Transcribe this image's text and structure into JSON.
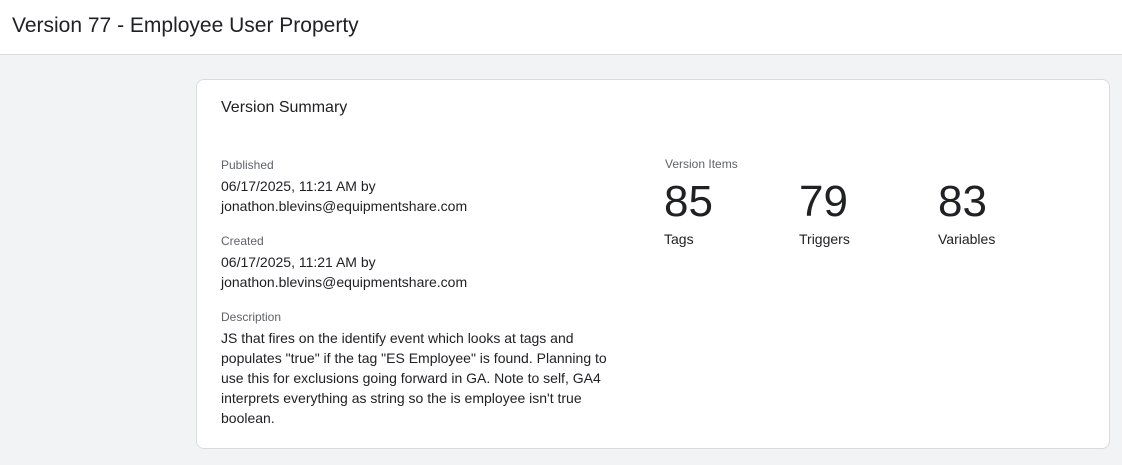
{
  "header": {
    "title": "Version 77 - Employee User Property"
  },
  "summary": {
    "title": "Version Summary",
    "published": {
      "label": "Published",
      "datetime": "06/17/2025, 11:21 AM by",
      "user": "jonathon.blevins@equipmentshare.com"
    },
    "created": {
      "label": "Created",
      "datetime": "06/17/2025, 11:21 AM by",
      "user": "jonathon.blevins@equipmentshare.com"
    },
    "description": {
      "label": "Description",
      "text": "JS that fires on the identify event which looks at tags and populates \"true\" if the tag \"ES Employee\" is found. Planning to use this for exclusions going forward in GA. Note to self, GA4 interprets everything as string so the is employee isn't true boolean."
    },
    "version_items": {
      "label": "Version Items",
      "tags": {
        "count": "85",
        "label": "Tags"
      },
      "triggers": {
        "count": "79",
        "label": "Triggers"
      },
      "variables": {
        "count": "83",
        "label": "Variables"
      }
    }
  }
}
